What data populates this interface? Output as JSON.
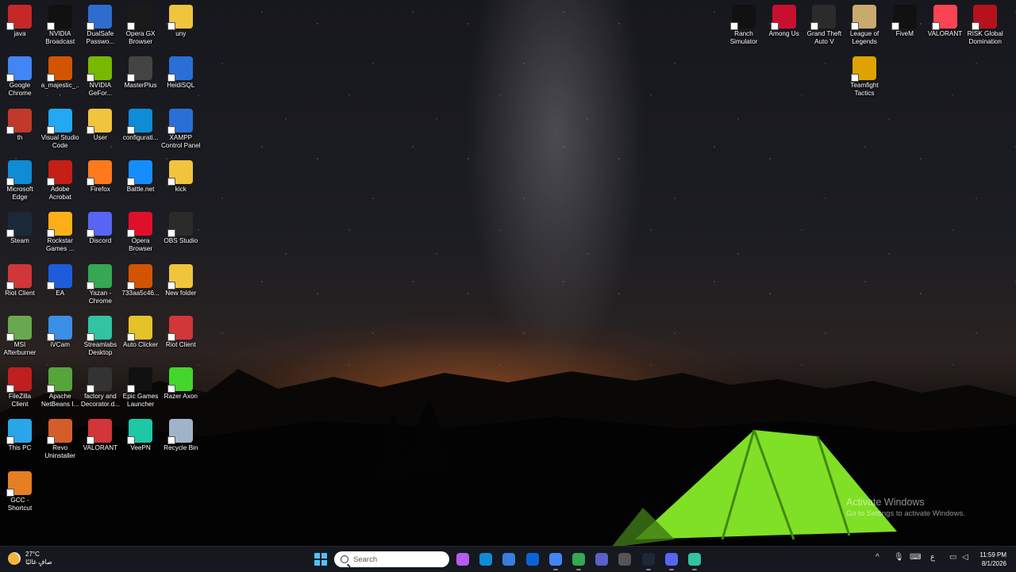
{
  "desktop_icons": [
    {
      "label": "java",
      "color": "#c62828"
    },
    {
      "label": "NVIDIA Broadcast",
      "color": "#111"
    },
    {
      "label": "DualSafe Passwo...",
      "color": "#2f6cd0"
    },
    {
      "label": "Opera GX Browser",
      "color": "#1a1a1a"
    },
    {
      "label": "uny",
      "color": "#f0c43c"
    },
    {
      "label": "Google Chrome",
      "color": "#4285f4"
    },
    {
      "label": "a_majestic_...",
      "color": "#d35400"
    },
    {
      "label": "NVIDIA GeFor...",
      "color": "#76b900"
    },
    {
      "label": "MasterPlus",
      "color": "#444"
    },
    {
      "label": "HeidiSQL",
      "color": "#2a6fd6"
    },
    {
      "label": "th",
      "color": "#c0392b"
    },
    {
      "label": "Visual Studio Code",
      "color": "#23a9f2"
    },
    {
      "label": "User",
      "color": "#f0c43c"
    },
    {
      "label": "configurati...",
      "color": "#0f8cd6"
    },
    {
      "label": "XAMPP Control Panel",
      "color": "#2a6fd6"
    },
    {
      "label": "Microsoft Edge",
      "color": "#0f8cd6"
    },
    {
      "label": "Adobe Acrobat",
      "color": "#c51f16"
    },
    {
      "label": "Firefox",
      "color": "#ff7a1a"
    },
    {
      "label": "Battle.net",
      "color": "#148eff"
    },
    {
      "label": "kick",
      "color": "#f0c43c"
    },
    {
      "label": "Steam",
      "color": "#1b2838"
    },
    {
      "label": "Rockstar Games ...",
      "color": "#fcaf17"
    },
    {
      "label": "Discord",
      "color": "#5865f2"
    },
    {
      "label": "Opera Browser",
      "color": "#e0102a"
    },
    {
      "label": "OBS Studio",
      "color": "#2b2b2b"
    },
    {
      "label": "Riot Client",
      "color": "#d13639"
    },
    {
      "label": "EA",
      "color": "#1e5cdc"
    },
    {
      "label": "Yazan - Chrome",
      "color": "#34a853"
    },
    {
      "label": "733aa5c46...",
      "color": "#d35400"
    },
    {
      "label": "New folder",
      "color": "#f0c43c"
    },
    {
      "label": "MSI Afterburner",
      "color": "#6aa84f"
    },
    {
      "label": "iVCam",
      "color": "#3b8fe6"
    },
    {
      "label": "Streamlabs Desktop",
      "color": "#31c3a2"
    },
    {
      "label": "Auto Clicker",
      "color": "#e6c229"
    },
    {
      "label": "Riot Client",
      "color": "#d13639"
    },
    {
      "label": "FileZilla Client",
      "color": "#bf1f1f"
    },
    {
      "label": "Apache NetBeans I...",
      "color": "#56a53b"
    },
    {
      "label": "factory and Decorator.d...",
      "color": "#333"
    },
    {
      "label": "Epic Games Launcher",
      "color": "#111"
    },
    {
      "label": "Razer Axon",
      "color": "#44d62c"
    },
    {
      "label": "This PC",
      "color": "#2aa6e8"
    },
    {
      "label": "Revo Uninstaller",
      "color": "#d45e2a"
    },
    {
      "label": "VALORANT",
      "color": "#d13639"
    },
    {
      "label": "VeePN",
      "color": "#1ec7a6"
    },
    {
      "label": "Recycle Bin",
      "color": "#9fb4c8"
    },
    {
      "label": "GCC - Shortcut",
      "color": "#e67e22"
    }
  ],
  "right_icons": [
    {
      "label": "Ranch Simulator",
      "color": "#111"
    },
    {
      "label": "Among Us",
      "color": "#c8102e"
    },
    {
      "label": "Grand Theft Auto V",
      "color": "#2b2b2b"
    },
    {
      "label": "League of Legends",
      "color": "#c8aa6e"
    },
    {
      "label": "FiveM",
      "color": "#111"
    },
    {
      "label": "VALORANT",
      "color": "#fa4454"
    },
    {
      "label": "RISK Global Domination",
      "color": "#b5121b"
    },
    {
      "label": "Teamfight Tactics",
      "color": "#e0a200"
    }
  ],
  "watermark": {
    "line1": "Activate Windows",
    "line2": "Go to Settings to activate Windows."
  },
  "taskbar": {
    "weather_temp": "27°C",
    "weather_desc": "صافٍ غالبًا",
    "search_placeholder": "Search",
    "apps": [
      {
        "name": "copilot",
        "color": "#b65cf0"
      },
      {
        "name": "edge",
        "color": "#0f8cd6"
      },
      {
        "name": "store",
        "color": "#3b7ddd"
      },
      {
        "name": "outlook",
        "color": "#0a64d8"
      },
      {
        "name": "chrome",
        "color": "#4285f4"
      },
      {
        "name": "chrome-profile",
        "color": "#34a853"
      },
      {
        "name": "teams",
        "color": "#5b5fc7"
      },
      {
        "name": "obs",
        "color": "#555"
      },
      {
        "name": "steam",
        "color": "#1b2838"
      },
      {
        "name": "discord",
        "color": "#5865f2"
      },
      {
        "name": "streamlabs",
        "color": "#31c3a2"
      }
    ],
    "tray_lang": "ع",
    "time": "11:59 PM",
    "date": "8/1/2026"
  }
}
